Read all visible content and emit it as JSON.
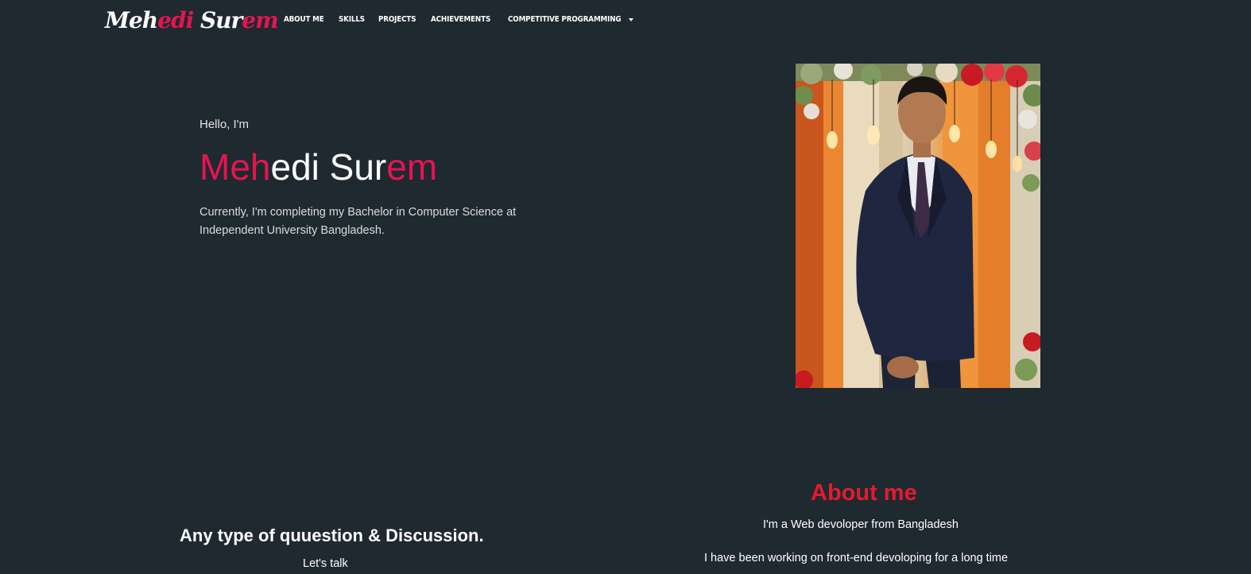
{
  "brand": {
    "part1": "Meh",
    "part2": "edi",
    "part3": " Sur",
    "part4": "em"
  },
  "nav": {
    "about": "About Me",
    "skills": "Skills",
    "projects": "Projects",
    "achievements": "Achievements",
    "competitive": "Competitive Programming"
  },
  "hero": {
    "greeting": "Hello, I'm",
    "name_part1": "Meh",
    "name_part2": "edi Sur",
    "name_part3": "em",
    "description": "Currently, I'm completing my Bachelor in Computer Science at Independent University Bangladesh."
  },
  "about": {
    "title": "About me",
    "line1": "I'm a Web devoloper from Bangladesh",
    "line2": "I have been working on front-end devoloping for a long time"
  },
  "contact": {
    "title": "Any type of quuestion & Discussion.",
    "subtitle": "Let's talk"
  },
  "colors": {
    "background": "#1f2930",
    "accent": "#e5154f",
    "about_title": "#e41b2f",
    "text": "#ffffff"
  },
  "icons": {
    "dropdown": "caret-down-icon"
  }
}
